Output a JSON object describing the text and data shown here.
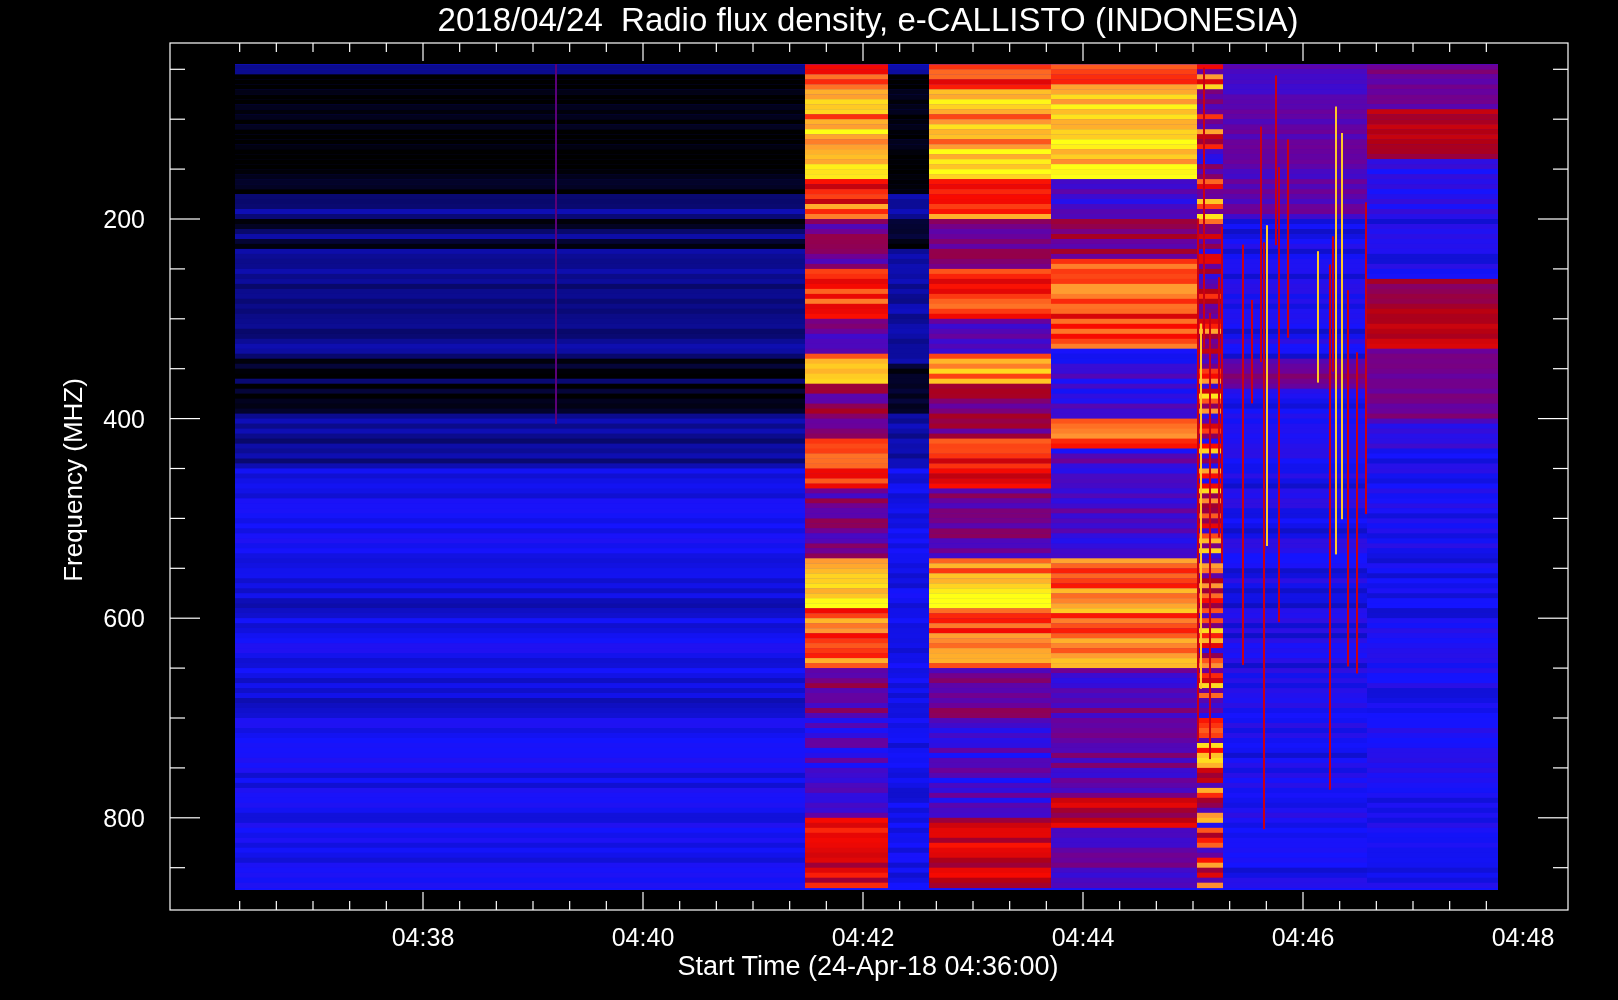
{
  "title": "2018/04/24  Radio flux density, e-CALLISTO (INDONESIA)",
  "y_axis": {
    "label": "Frequency (MHZ)",
    "ticks": [
      "200",
      "400",
      "600",
      "800"
    ]
  },
  "x_axis": {
    "label": "Start Time (24-Apr-18 04:36:00)",
    "ticks": [
      "04:38",
      "04:40",
      "04:42",
      "04:44",
      "04:46",
      "04:48"
    ]
  }
}
